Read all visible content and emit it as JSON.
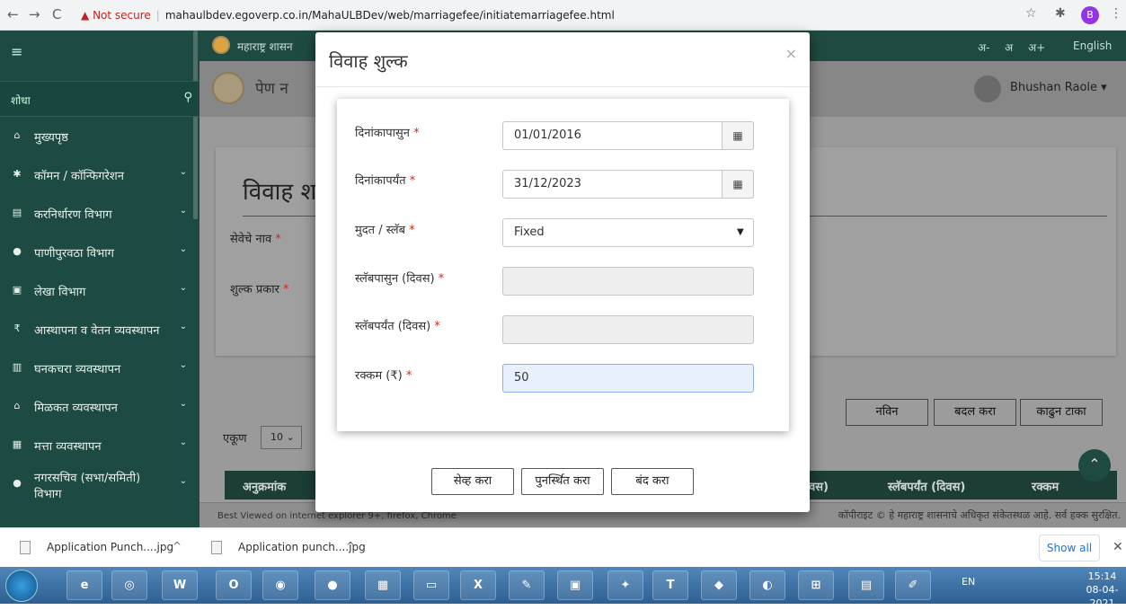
{
  "browser": {
    "not_secure": "Not secure",
    "url": "mahaulbdev.egoverp.co.in/MahaULBDev/web/marriagefee/initiatemarriagefee.html",
    "profile_initial": "B"
  },
  "sidebar": {
    "search_label": "शोधा",
    "items": [
      {
        "icon": "home-icon",
        "label": "मुख्यपृष्ठ",
        "chevron": false
      },
      {
        "icon": "settings-icon",
        "label": "कॉमन / कॉन्फिगरेशन",
        "chevron": true
      },
      {
        "icon": "tax-icon",
        "label": "करनिर्धारण विभाग",
        "chevron": true
      },
      {
        "icon": "water-icon",
        "label": "पाणीपुरवठा विभाग",
        "chevron": true
      },
      {
        "icon": "accounts-icon",
        "label": "लेखा विभाग",
        "chevron": true
      },
      {
        "icon": "rupee-icon",
        "label": "आस्थापना व वेतन व्यवस्थापन",
        "chevron": true
      },
      {
        "icon": "waste-icon",
        "label": "घनकचरा व्यवस्थापन",
        "chevron": true
      },
      {
        "icon": "property-icon",
        "label": "मिळकत व्यवस्थापन",
        "chevron": true
      },
      {
        "icon": "assets-icon",
        "label": "मत्ता व्यवस्थापन",
        "chevron": true
      },
      {
        "icon": "user-icon",
        "label": "नगरसचिव (सभा/समिती) विभाग",
        "chevron": true
      }
    ]
  },
  "topbar": {
    "gov_label": "महाराष्ट्र शासन",
    "font_minus": "अ-",
    "font_normal": "अ",
    "font_plus": "अ+",
    "language": "English"
  },
  "header": {
    "municipality": "पेण न",
    "user_name": "Bhushan Raole"
  },
  "panel": {
    "title": "विवाह श",
    "service_name_label": "सेवेचे नाव",
    "fee_type_label": "शुल्क प्रकार"
  },
  "actions": {
    "new": "नविन",
    "edit": "बदल करा",
    "delete": "काढुन टाका"
  },
  "table": {
    "entries_label": "एकूण",
    "entries_value": "10",
    "headers": [
      "अनुक्रमांक",
      "वस)",
      "स्लॅबपर्यंत (दिवस)",
      "रक्कम"
    ]
  },
  "footer": {
    "left": "Best Viewed on internet explorer 9+, firefox, Chrome",
    "right": "कॉपीराइट © हे महाराष्ट्र शासनाचे अधिकृत संकेतस्थळ आहे. सर्व हक्क सुरक्षित."
  },
  "modal": {
    "title": "विवाह शुल्क",
    "close": "×",
    "fields": {
      "from_date_label": "दिनांकापासुन",
      "from_date_value": "01/01/2016",
      "to_date_label": "दिनांकापर्यंत",
      "to_date_value": "31/12/2023",
      "period_label": "मुदत / स्लॅब",
      "period_value": "Fixed",
      "slab_from_label": "स्लॅबपासुन (दिवस)",
      "slab_from_value": "",
      "slab_to_label": "स्लॅबपर्यंत (दिवस)",
      "slab_to_value": "",
      "amount_label": "रक्कम (₹)",
      "amount_value": "50"
    },
    "buttons": {
      "save": "सेव्ह करा",
      "reset": "पुनर्स्थित करा",
      "close": "बंद करा"
    }
  },
  "downloads": {
    "items": [
      "Application Punch....jpg",
      "Application punch....jpg"
    ],
    "show_all": "Show all"
  },
  "taskbar": {
    "lang": "EN",
    "time": "15:14",
    "date": "08-04-2021"
  }
}
